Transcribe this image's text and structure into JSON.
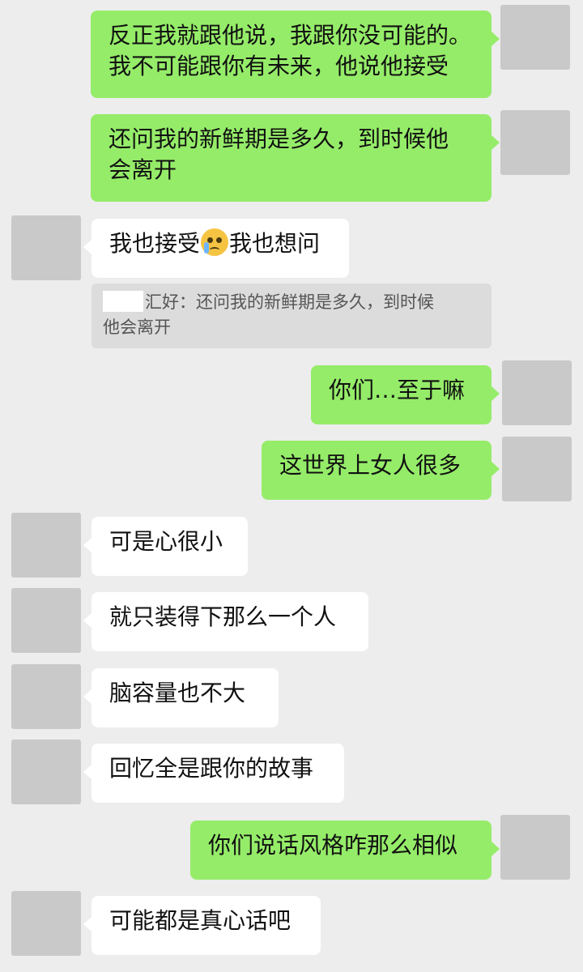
{
  "messages": [
    {
      "side": "out",
      "lines": [
        "反正我就跟他说，我跟你没可能的。",
        "我不可能跟你有未来，他说他接受"
      ]
    },
    {
      "side": "out",
      "lines": [
        "还问我的新鲜期是多久，到时候他",
        "会离开"
      ]
    },
    {
      "side": "in",
      "text_before": "我也接受",
      "emoji": "crying-face-emoji",
      "text_after": "我也想问"
    },
    {
      "side": "out",
      "text": "你们…至于嘛"
    },
    {
      "side": "out",
      "text": "这世界上女人很多"
    },
    {
      "side": "in",
      "text": "可是心很小"
    },
    {
      "side": "in",
      "text": "就只装得下那么一个人"
    },
    {
      "side": "in",
      "text": "脑容量也不大"
    },
    {
      "side": "in",
      "text": "回忆全是跟你的故事"
    },
    {
      "side": "out",
      "text": "你们说话风格咋那么相似"
    },
    {
      "side": "in",
      "text": "可能都是真心话吧"
    }
  ],
  "quote": {
    "sender_suffix": "汇好：",
    "lines": [
      "还问我的新鲜期是多久，到时候",
      "他会离开"
    ]
  },
  "colors": {
    "background": "#ededed",
    "outgoing_bubble": "#95ec69",
    "incoming_bubble": "#ffffff",
    "quote_background": "#dcdcdc",
    "avatar_placeholder": "#c9c9c9"
  }
}
